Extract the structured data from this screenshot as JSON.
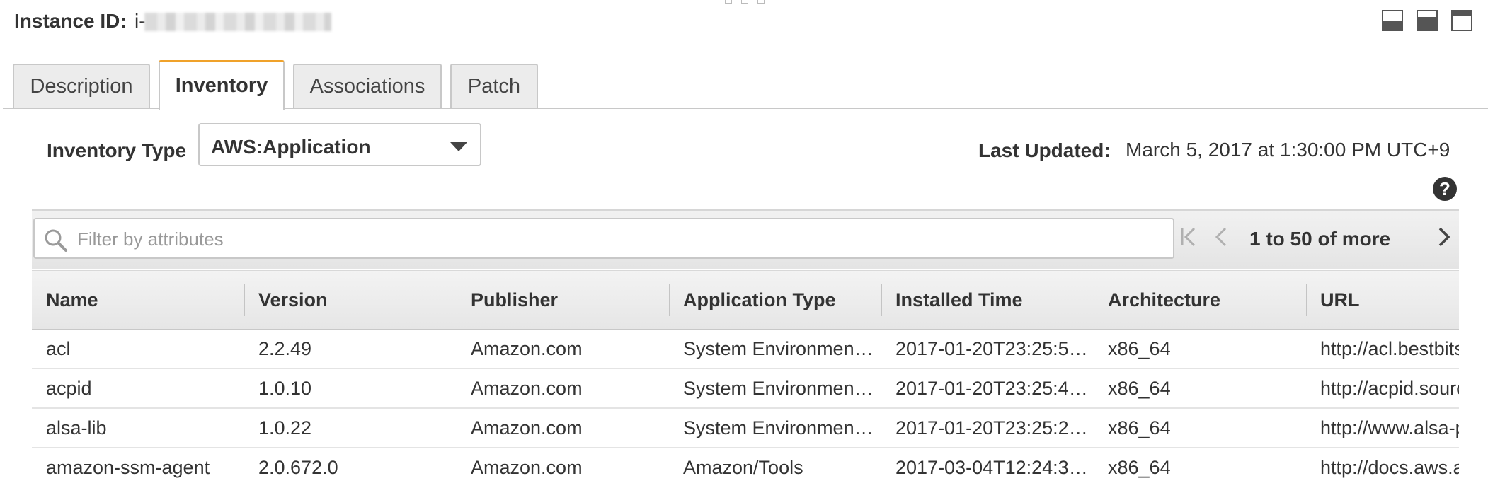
{
  "header": {
    "instance_label": "Instance ID:",
    "instance_prefix": "i-"
  },
  "tabs": [
    {
      "label": "Description",
      "active": false
    },
    {
      "label": "Inventory",
      "active": true
    },
    {
      "label": "Associations",
      "active": false
    },
    {
      "label": "Patch",
      "active": false
    }
  ],
  "inventory": {
    "type_label": "Inventory Type",
    "type_value": "AWS:Application",
    "last_updated_label": "Last Updated:",
    "last_updated_value": "March 5, 2017 at 1:30:00 PM UTC+9"
  },
  "filter": {
    "placeholder": "Filter by attributes",
    "pager_text": "1 to 50 of more"
  },
  "table": {
    "columns": [
      "Name",
      "Version",
      "Publisher",
      "Application Type",
      "Installed Time",
      "Architecture",
      "URL"
    ],
    "rows": [
      [
        "acl",
        "2.2.49",
        "Amazon.com",
        "System Environmen…",
        "2017-01-20T23:25:5…",
        "x86_64",
        "http://acl.bestbits"
      ],
      [
        "acpid",
        "1.0.10",
        "Amazon.com",
        "System Environmen…",
        "2017-01-20T23:25:4…",
        "x86_64",
        "http://acpid.sourc"
      ],
      [
        "alsa-lib",
        "1.0.22",
        "Amazon.com",
        "System Environmen…",
        "2017-01-20T23:25:2…",
        "x86_64",
        "http://www.alsa-p"
      ],
      [
        "amazon-ssm-agent",
        "2.0.672.0",
        "Amazon.com",
        "Amazon/Tools",
        "2017-03-04T12:24:3…",
        "x86_64",
        "http://docs.aws.a"
      ]
    ]
  },
  "colors": {
    "active_tab_accent": "#f0a22a",
    "header_bg": "#e6e6e6",
    "border": "#c8c8c8"
  },
  "icons": [
    "panel-bottom-icon",
    "panel-split-icon",
    "panel-top-icon",
    "help-icon",
    "search-icon",
    "first-page-icon",
    "prev-page-icon",
    "next-page-icon",
    "dropdown-caret-icon"
  ]
}
